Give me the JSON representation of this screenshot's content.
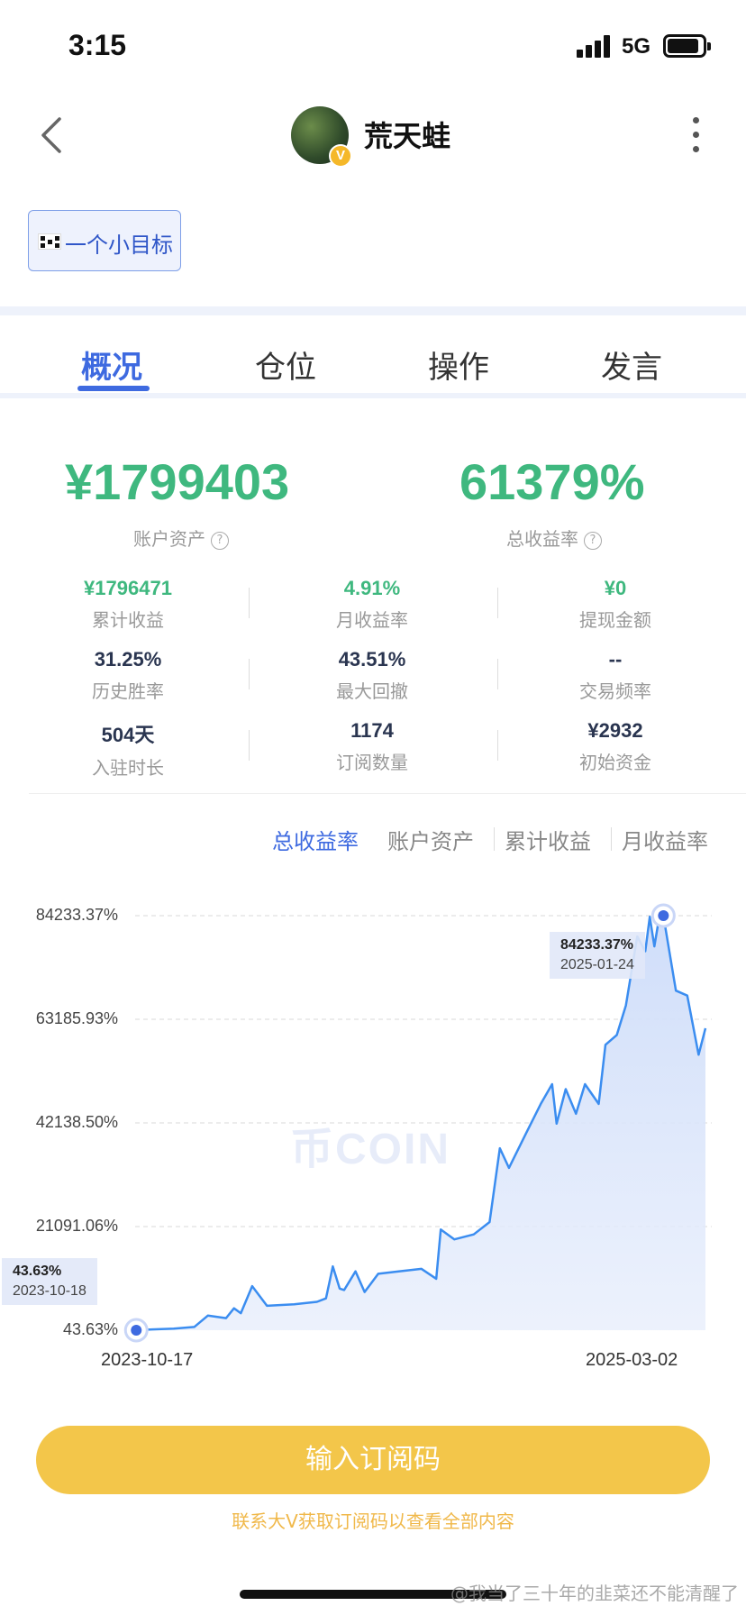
{
  "status_bar": {
    "time": "3:15",
    "network": "5G"
  },
  "header": {
    "nickname": "荒天蛙",
    "badge": "V"
  },
  "tag": {
    "label": "一个小目标"
  },
  "tabs": [
    {
      "label": "概况",
      "active": true
    },
    {
      "label": "仓位",
      "active": false
    },
    {
      "label": "操作",
      "active": false
    },
    {
      "label": "发言",
      "active": false
    }
  ],
  "summary": {
    "account_assets": {
      "value": "¥1799403",
      "label": "账户资产"
    },
    "total_return": {
      "value": "61379%",
      "label": "总收益率"
    },
    "help_glyph": "?"
  },
  "stats": [
    {
      "value": "¥1796471",
      "label": "累计收益",
      "green": true
    },
    {
      "value": "4.91%",
      "label": "月收益率",
      "green": true
    },
    {
      "value": "¥0",
      "label": "提现金额",
      "green": true
    },
    {
      "value": "31.25%",
      "label": "历史胜率",
      "green": false
    },
    {
      "value": "43.51%",
      "label": "最大回撤",
      "green": false
    },
    {
      "value": "--",
      "label": "交易频率",
      "green": false
    },
    {
      "value": "504天",
      "label": "入驻时长",
      "green": false
    },
    {
      "value": "1174",
      "label": "订阅数量",
      "green": false
    },
    {
      "value": "¥2932",
      "label": "初始资金",
      "green": false
    }
  ],
  "chart_tabs": [
    {
      "label": "总收益率",
      "active": true
    },
    {
      "label": "账户资产",
      "active": false
    },
    {
      "label": "累计收益",
      "active": false
    },
    {
      "label": "月收益率",
      "active": false
    }
  ],
  "chart_data": {
    "type": "area",
    "title": "",
    "xlabel": "",
    "ylabel": "",
    "y_ticks": [
      "84233.37%",
      "63185.93%",
      "42138.50%",
      "21091.06%",
      "43.63%"
    ],
    "ylim": [
      43.63,
      84233.37
    ],
    "x_ticks": [
      "2023-10-17",
      "2025-03-02"
    ],
    "xlim": [
      "2023-10-17",
      "2025-03-02"
    ],
    "grid": true,
    "line_color": "#3b8df0",
    "fill_color": "#dfe8fb",
    "series": [
      {
        "values": [
          [
            "2023-10-17",
            43.63
          ],
          [
            "2023-11-01",
            200
          ],
          [
            "2023-11-20",
            350
          ],
          [
            "2023-12-08",
            700
          ],
          [
            "2023-12-20",
            3000
          ],
          [
            "2024-01-05",
            2500
          ],
          [
            "2024-01-12",
            4500
          ],
          [
            "2024-01-18",
            3500
          ],
          [
            "2024-01-28",
            9000
          ],
          [
            "2024-02-10",
            5000
          ],
          [
            "2024-03-05",
            5300
          ],
          [
            "2024-03-25",
            5800
          ],
          [
            "2024-04-02",
            6500
          ],
          [
            "2024-04-08",
            13000
          ],
          [
            "2024-04-14",
            8500
          ],
          [
            "2024-04-18",
            8200
          ],
          [
            "2024-04-28",
            12000
          ],
          [
            "2024-05-06",
            7800
          ],
          [
            "2024-05-18",
            11500
          ],
          [
            "2024-06-05",
            12000
          ],
          [
            "2024-06-25",
            12500
          ],
          [
            "2024-07-08",
            10500
          ],
          [
            "2024-07-12",
            20500
          ],
          [
            "2024-07-24",
            18500
          ],
          [
            "2024-08-10",
            19500
          ],
          [
            "2024-08-24",
            22000
          ],
          [
            "2024-09-02",
            37000
          ],
          [
            "2024-09-10",
            33000
          ],
          [
            "2024-09-25",
            40000
          ],
          [
            "2024-10-08",
            46000
          ],
          [
            "2024-10-18",
            50000
          ],
          [
            "2024-10-22",
            42000
          ],
          [
            "2024-10-30",
            49000
          ],
          [
            "2024-11-08",
            44000
          ],
          [
            "2024-11-16",
            50000
          ],
          [
            "2024-11-28",
            46000
          ],
          [
            "2024-12-04",
            58000
          ],
          [
            "2024-12-14",
            60000
          ],
          [
            "2024-12-22",
            66000
          ],
          [
            "2025-01-01",
            80000
          ],
          [
            "2025-01-08",
            77000
          ],
          [
            "2025-01-12",
            84000
          ],
          [
            "2025-01-16",
            78000
          ],
          [
            "2025-01-20",
            83500
          ],
          [
            "2025-01-24",
            84233.37
          ],
          [
            "2025-02-04",
            69000
          ],
          [
            "2025-02-14",
            68000
          ],
          [
            "2025-02-24",
            56000
          ],
          [
            "2025-03-02",
            61379
          ]
        ]
      }
    ],
    "highlighted_points": [
      {
        "date": "2025-01-24",
        "value": 84233.37,
        "label_value": "84233.37%",
        "label_date": "2025-01-24"
      },
      {
        "date": "2023-10-18",
        "value": 43.63,
        "label_value": "43.63%",
        "label_date": "2023-10-18"
      }
    ]
  },
  "watermark": "币COIN",
  "cta": {
    "label": "输入订阅码",
    "note": "联系大V获取订阅码以查看全部内容"
  },
  "credit": "@我当了三十年的韭菜还不能清醒了"
}
